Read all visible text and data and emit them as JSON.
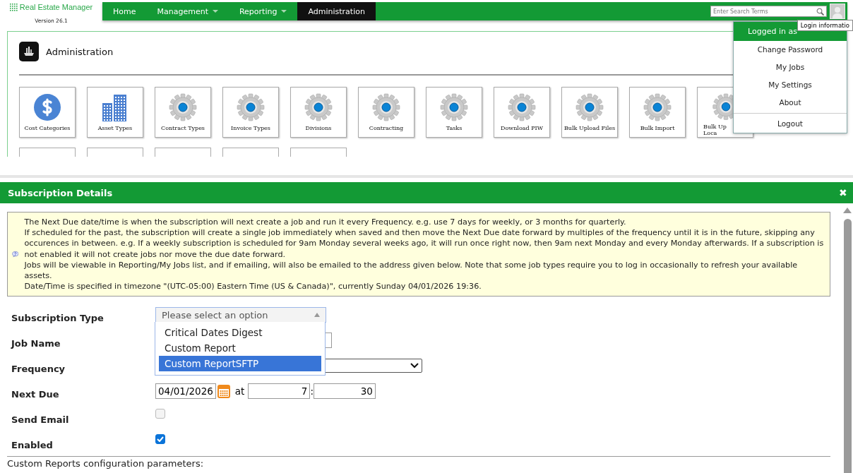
{
  "header": {
    "logo": {
      "name": "Real Estate Manager",
      "version": "Version 26.1"
    },
    "nav": [
      {
        "label": "Home",
        "selected": false,
        "dropdown": false
      },
      {
        "label": "Management",
        "selected": false,
        "dropdown": true
      },
      {
        "label": "Reporting",
        "selected": false,
        "dropdown": true
      },
      {
        "label": "Administration",
        "selected": true,
        "dropdown": false
      }
    ],
    "search": {
      "placeholder": "Enter Search Terms"
    },
    "tooltip": "Login informatio"
  },
  "user_menu": {
    "header": "Logged in as",
    "items": [
      "Change Password",
      "My Jobs",
      "My Settings",
      "About"
    ],
    "logout": "Logout"
  },
  "admin": {
    "title": "Administration",
    "tiles": [
      {
        "label": "Cost Categories",
        "kind": "dollar"
      },
      {
        "label": "Asset Types",
        "kind": "buildings"
      },
      {
        "label": "Contract Types",
        "kind": "gear"
      },
      {
        "label": "Invoice Types",
        "kind": "gear"
      },
      {
        "label": "Divisions",
        "kind": "gear"
      },
      {
        "label": "Contracting",
        "kind": "gear"
      },
      {
        "label": "Tasks",
        "kind": "gear"
      },
      {
        "label": "Download PIW",
        "kind": "gear"
      },
      {
        "label": "Bulk Upload Files",
        "kind": "gear"
      },
      {
        "label": "Bulk Import",
        "kind": "gear"
      },
      {
        "label": "Bulk Up",
        "label_2": "Loca",
        "kind": "covered"
      }
    ],
    "tiles_row_2": [
      {
        "kind": "cut"
      },
      {
        "kind": "cut"
      },
      {
        "kind": "cut"
      },
      {
        "kind": "cut"
      },
      {
        "kind": "cut"
      }
    ]
  },
  "dialog": {
    "title": "Subscription Details",
    "close": "✖",
    "info": [
      "The Next Due date/time is when the subscription will next create a job and run it every Frequency. e.g. use 7 days for weekly, or 3 months for quarterly.",
      "If scheduled for the past, the subscription will create a single job immediately when saved and then move the Next Due date forward by multiples of the frequency until it is in the future, skipping any occurences in between. e.g. If a weekly subscription is scheduled for 9am Monday several weeks ago, it will run once right now, then 9am next Monday and every Monday afterwards. If a subscription is not enabled it will not create jobs nor move the due date forward.",
      "Jobs will be viewable in Reporting/My Jobs list, and if emailing, will also be emailed to the address given below. Note that some job types require you to log in occasionally to refresh your available assets.",
      "Date/Time is specified in timezone \"(UTC-05:00) Eastern Time (US & Canada)\", currently Sunday 04/01/2026 19:36."
    ],
    "fields": [
      {
        "label": "Subscription Type",
        "kind": "dropdown",
        "placeholder": "Please select an option",
        "options": [
          {
            "label": "Critical Dates Digest",
            "selected": false
          },
          {
            "label": "Custom Report",
            "selected": false
          },
          {
            "label": "Custom ReportSFTP",
            "selected": true
          }
        ]
      },
      {
        "label": "Job Name",
        "kind": "text"
      },
      {
        "label": "Frequency",
        "kind": "select"
      },
      {
        "label": "Next Due",
        "kind": "datetime",
        "date": "04/01/2026",
        "at": "at",
        "hour": "7",
        "separator": ":",
        "minute": "30"
      },
      {
        "label": "Send Email",
        "kind": "checkbox",
        "checked": false
      },
      {
        "label": "Enabled",
        "kind": "checkbox",
        "checked": true
      }
    ],
    "section": "Custom Reports configuration parameters:"
  }
}
